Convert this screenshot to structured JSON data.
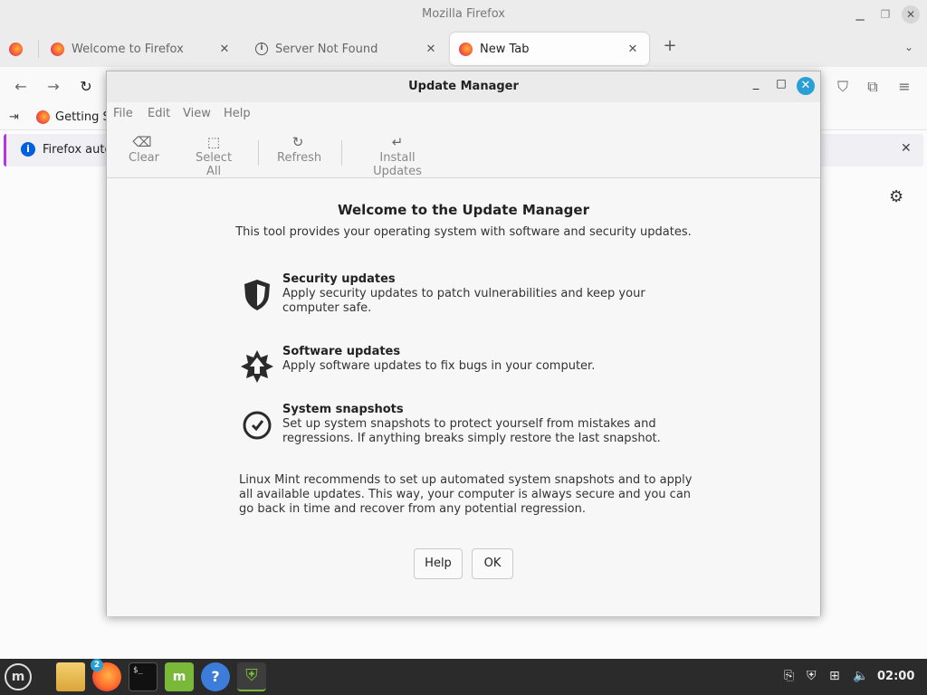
{
  "firefox": {
    "window_title": "Mozilla Firefox",
    "tabs": [
      {
        "label": "Welcome to Firefox"
      },
      {
        "label": "Server Not Found"
      },
      {
        "label": "New Tab"
      }
    ],
    "bookmarks": {
      "getting_started": "Getting S"
    },
    "notification": {
      "text": "Firefox auto"
    }
  },
  "update_manager": {
    "title": "Update Manager",
    "menu": [
      "File",
      "Edit",
      "View",
      "Help"
    ],
    "toolbar": [
      {
        "label": "Clear",
        "icon": "backspace-icon"
      },
      {
        "label": "Select All",
        "icon": "select-all-icon"
      },
      {
        "label": "Refresh",
        "icon": "refresh-icon"
      },
      {
        "label": "Install Updates",
        "icon": "install-icon"
      }
    ],
    "heading": "Welcome to the Update Manager",
    "subheading": "This tool provides your operating system with software and security updates.",
    "features": [
      {
        "title": "Security updates",
        "description": "Apply security updates to patch vulnerabilities and keep your computer safe.",
        "icon": "shield-icon"
      },
      {
        "title": "Software updates",
        "description": "Apply software updates to fix bugs in your computer.",
        "icon": "star-arrow-icon"
      },
      {
        "title": "System snapshots",
        "description": "Set up system snapshots to protect yourself from mistakes and regressions. If anything breaks simply restore the last snapshot.",
        "icon": "clock-icon"
      }
    ],
    "recommendation": "Linux Mint recommends to set up automated system snapshots and to apply all available updates. This way, your computer is always secure and you can go back in time and recover from any potential regression.",
    "buttons": {
      "help": "Help",
      "ok": "OK"
    }
  },
  "taskbar": {
    "firefox_badge": "2",
    "terminal_prompt": "$_",
    "clock": "02:00"
  },
  "colors": {
    "accent": "#2a9fd6",
    "mint_green": "#7ab83a",
    "taskbar_bg": "#2b2b2b"
  }
}
